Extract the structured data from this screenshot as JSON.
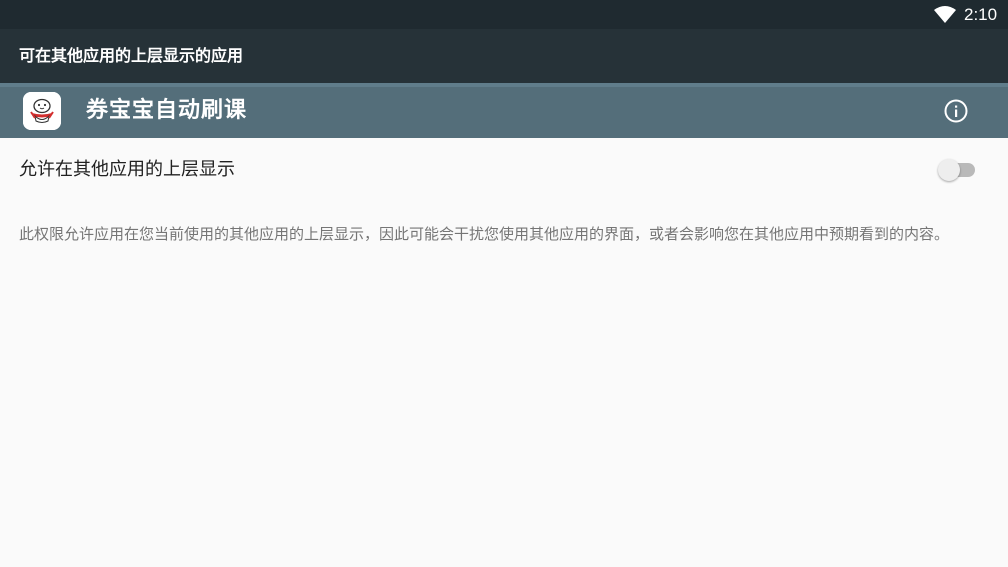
{
  "status_bar": {
    "time": "2:10",
    "wifi_icon": "wifi-full-icon"
  },
  "title_bar": {
    "title": "可在其他应用的上层显示的应用"
  },
  "app_header": {
    "name": "券宝宝自动刷课",
    "icon": "app-icon",
    "info_icon": "info-icon"
  },
  "setting": {
    "label": "允许在其他应用的上层显示",
    "toggle_on": false
  },
  "description": "此权限允许应用在您当前使用的其他应用的上层显示，因此可能会干扰您使用其他应用的界面，或者会影响您在其他应用中预期看到的内容。",
  "colors": {
    "status_bar": "#1f2a30",
    "title_bar": "#263238",
    "app_header": "#546e7a",
    "background": "#fafafa"
  }
}
